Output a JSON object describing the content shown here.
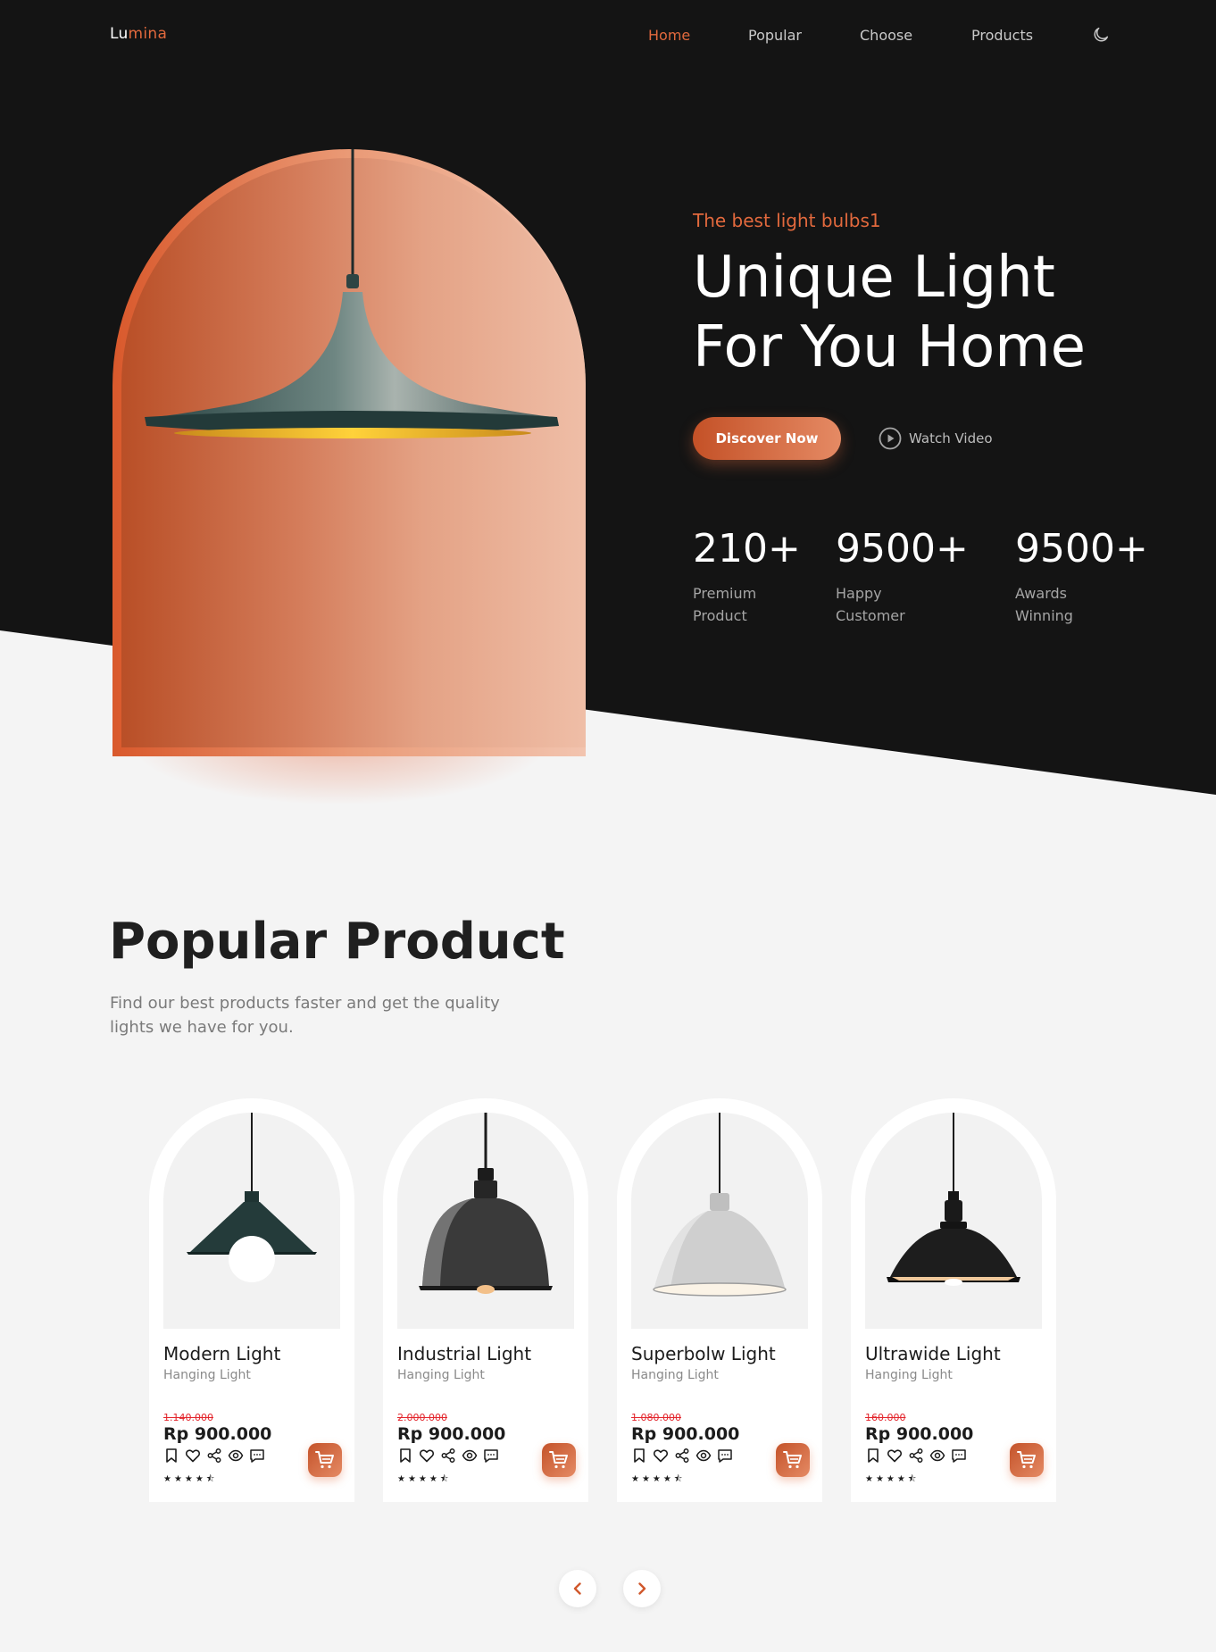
{
  "nav": {
    "logo_a": "Lu",
    "logo_b": "mina",
    "links": [
      "Home",
      "Popular",
      "Choose",
      "Products"
    ],
    "active": "Home",
    "theme_icon": "moon-icon"
  },
  "hero": {
    "subtitle": "The best light bulbs1",
    "title_line1": "Unique Light",
    "title_line2": "For You Home",
    "discover_label": "Discover Now",
    "watch_label": "Watch Video",
    "stats": [
      {
        "value": "210+",
        "label": "Premium Product"
      },
      {
        "value": "9500+",
        "label": "Happy Customer"
      },
      {
        "value": "9500+",
        "label": "Awards Winning"
      }
    ]
  },
  "popular": {
    "title": "Popular Product",
    "description": "Find our best products faster and get the quality lights we have for you.",
    "products": [
      {
        "name": "Modern Light",
        "type": "Hanging Light",
        "old_price": "1.140.000",
        "price": "Rp 900.000",
        "rating": 4.5
      },
      {
        "name": "Industrial Light",
        "type": "Hanging Light",
        "old_price": "2.000.000",
        "price": "Rp 900.000",
        "rating": 4.5
      },
      {
        "name": "Superbolw Light",
        "type": "Hanging Light",
        "old_price": "1.080.000",
        "price": "Rp 900.000",
        "rating": 4.5
      },
      {
        "name": "Ultrawide Light",
        "type": "Hanging Light",
        "old_price": "160.000",
        "price": "Rp 900.000",
        "rating": 4.5
      }
    ],
    "action_icons": [
      "bookmark-icon",
      "heart-icon",
      "share-icon",
      "eye-icon",
      "comment-icon"
    ],
    "cart_icon": "cart-icon",
    "pager_icons": [
      "chevron-left-icon",
      "chevron-right-icon"
    ]
  },
  "colors": {
    "accent": "#e2693d",
    "dark": "#141414",
    "light_bg": "#f4f4f4",
    "sale": "#e3242b"
  }
}
